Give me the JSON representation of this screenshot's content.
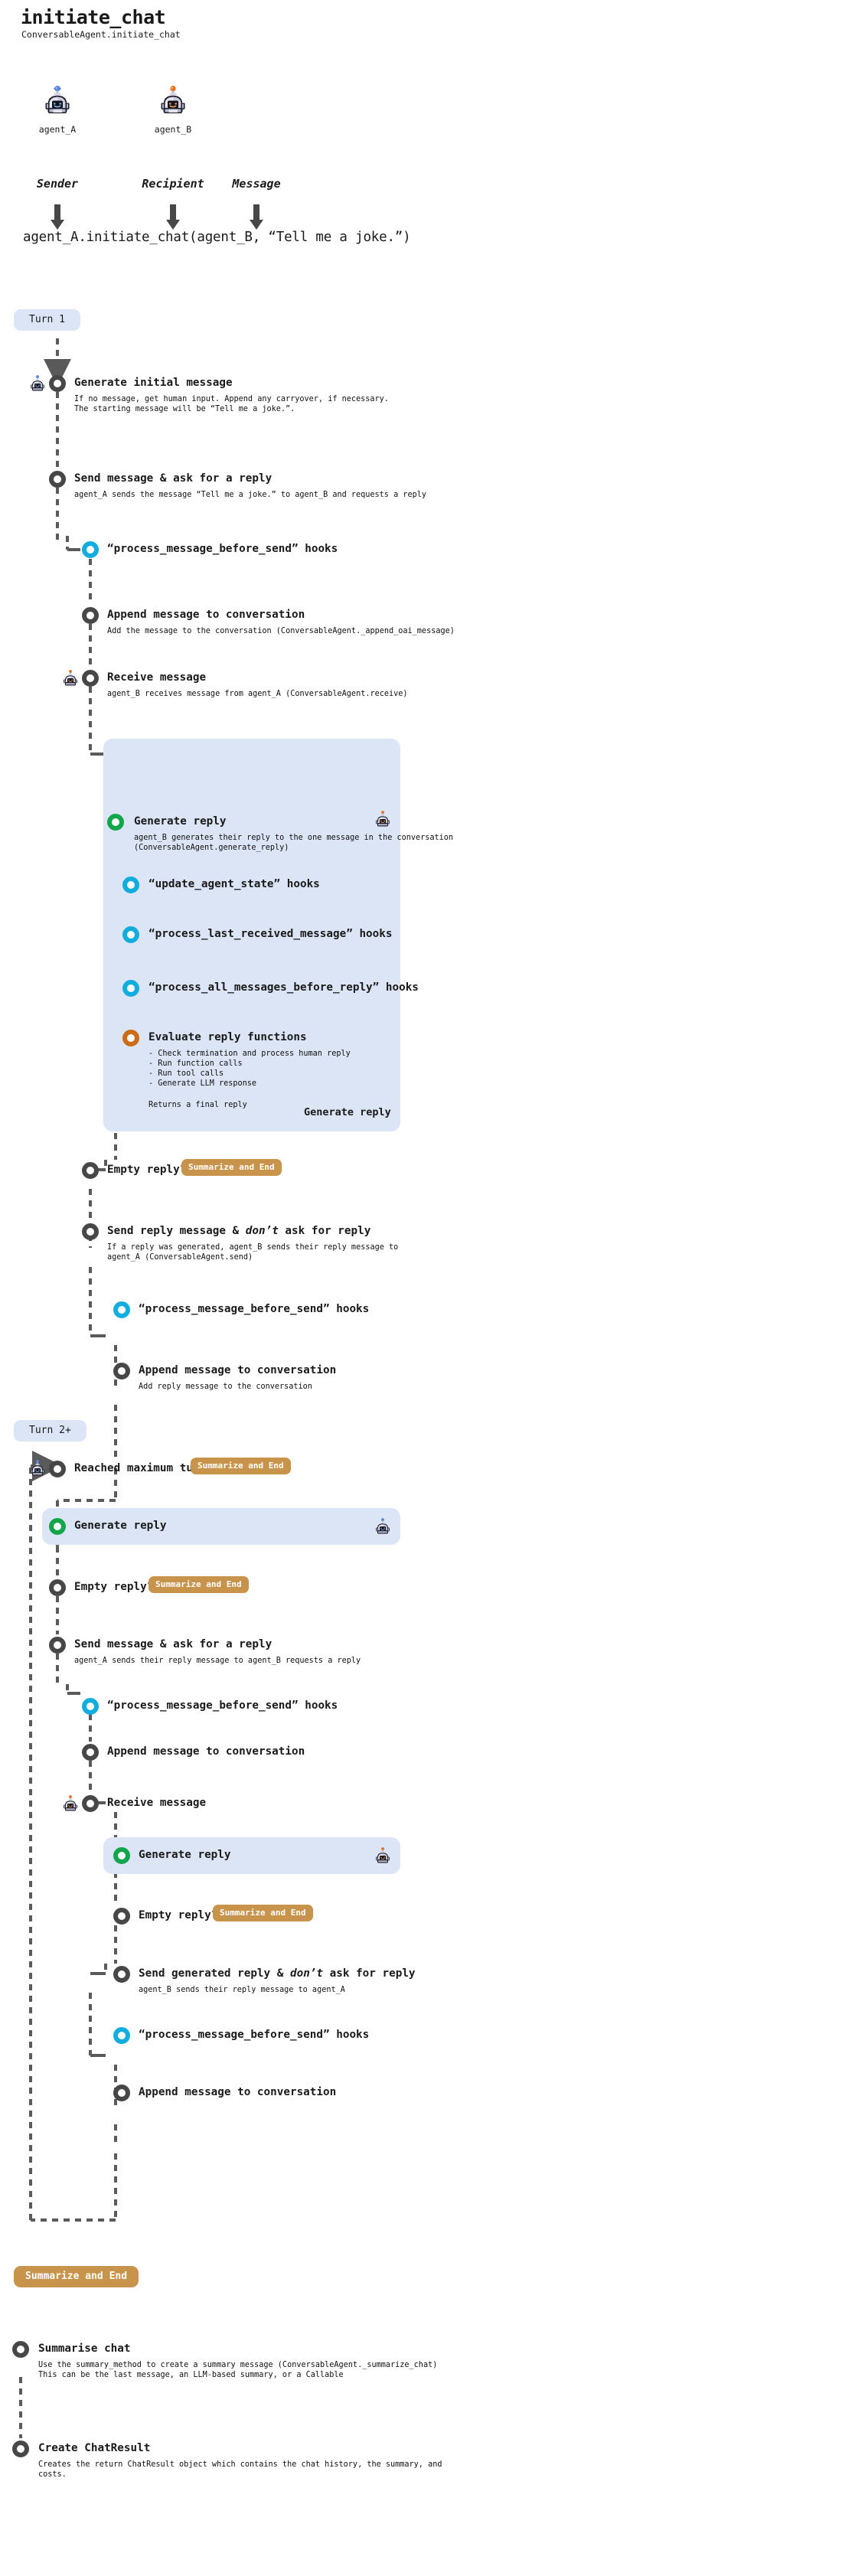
{
  "header": {
    "title": "initiate_chat",
    "subtitle": "ConversableAgent.initiate_chat",
    "agent_a_name": "agent_A",
    "agent_b_name": "agent_B",
    "role_sender": "Sender",
    "role_recipient": "Recipient",
    "role_message": "Message",
    "call_line": "agent_A.initiate_chat(agent_B, “Tell me a joke.”)"
  },
  "colors": {
    "node_dark": "#474747",
    "node_green": "#11a64a",
    "node_cyan": "#12addf",
    "node_orange": "#cc6b16",
    "highlight_bg": "#dbe5f5",
    "badge_bg": "#c8944c",
    "turn_badge_bg": "#dbe5f5",
    "line": "#5a5a5a"
  },
  "turn1": {
    "badge": "Turn 1",
    "steps": [
      {
        "id": "generate-initial-message",
        "label": "Generate initial message",
        "desc": "If no message, get human input. Append any carryover, if necessary.\nThe starting message will be “Tell me a joke.”.",
        "node": "dark",
        "agent_icon": "agent_A"
      },
      {
        "id": "send-message-ask-reply",
        "label": "Send message & ask for a reply",
        "desc": "agent_A sends the message “Tell me a joke.” to agent_B and requests a reply",
        "node": "dark"
      },
      {
        "id": "process-message-before-send-hook-1",
        "label": "“process_message_before_send” hooks",
        "desc": "",
        "node": "cyan"
      },
      {
        "id": "append-message-to-conversation-1",
        "label": "Append message to conversation",
        "desc": "Add the message to the conversation (ConversableAgent._append_oai_message)",
        "node": "dark"
      },
      {
        "id": "receive-message-1",
        "label": "Receive message",
        "desc": "agent_B receives message from agent_A (ConversableAgent.receive)",
        "node": "dark",
        "agent_icon": "agent_B"
      }
    ],
    "generate_reply_block": {
      "label": "Generate reply",
      "desc": "agent_B generates their reply to the one message in the conversation\n(ConversableAgent.generate_reply)",
      "footer_label": "Generate reply",
      "agent_icon": "agent_B",
      "inner": [
        {
          "id": "update-agent-state-hooks",
          "label": "“update_agent_state” hooks",
          "node": "cyan"
        },
        {
          "id": "process-last-received-message-hooks",
          "label": "“process_last_received_message” hooks",
          "node": "cyan"
        },
        {
          "id": "process-all-messages-before-reply-hooks",
          "label": "“process_all_messages_before_reply” hooks",
          "node": "cyan"
        },
        {
          "id": "evaluate-reply-functions",
          "label": "Evaluate reply functions",
          "node": "orange",
          "bullets": [
            "- Check termination and process human reply",
            "- Run function calls",
            "- Run tool calls",
            "- Generate LLM response"
          ],
          "returns": "Returns a final reply"
        }
      ]
    },
    "post_steps": [
      {
        "id": "empty-reply-1",
        "label": "Empty reply?",
        "badge": "Summarize and End",
        "node": "dark"
      },
      {
        "id": "send-reply-dont-ask",
        "label_parts": [
          "Send reply message & ",
          "don’t",
          " ask for reply"
        ],
        "desc": "If a reply was generated, agent_B sends their reply message to\nagent_A (ConversableAgent.send)",
        "node": "dark"
      },
      {
        "id": "process-message-before-send-hook-2",
        "label": "“process_message_before_send” hooks",
        "node": "cyan"
      },
      {
        "id": "append-message-to-conversation-2",
        "label": "Append message to conversation",
        "desc": "Add reply message to the conversation",
        "node": "dark"
      }
    ]
  },
  "turn2": {
    "badge": "Turn 2+",
    "steps": [
      {
        "id": "reached-maximum-turns",
        "label": "Reached maximum turns?",
        "badge": "Summarize and End",
        "node": "dark",
        "agent_icon": "agent_A"
      },
      {
        "id": "generate-reply-a",
        "label": "Generate reply",
        "node": "green",
        "highlight": true,
        "agent_icon": "agent_A"
      },
      {
        "id": "empty-reply-2",
        "label": "Empty reply?",
        "badge": "Summarize and End",
        "node": "dark"
      },
      {
        "id": "send-message-ask-reply-2",
        "label": "Send message & ask for a reply",
        "desc": "agent_A sends their reply message to agent_B requests a reply",
        "node": "dark"
      },
      {
        "id": "process-message-before-send-hook-3",
        "label": "“process_message_before_send” hooks",
        "node": "cyan"
      },
      {
        "id": "append-message-to-conversation-3",
        "label": "Append message to conversation",
        "node": "dark"
      },
      {
        "id": "receive-message-2",
        "label": "Receive message",
        "node": "dark",
        "agent_icon": "agent_B"
      },
      {
        "id": "generate-reply-b",
        "label": "Generate reply",
        "node": "green",
        "highlight": true,
        "agent_icon": "agent_B"
      },
      {
        "id": "empty-reply-3",
        "label": "Empty reply?",
        "badge": "Summarize and End",
        "node": "dark"
      },
      {
        "id": "send-generated-reply-dont-ask",
        "label_parts": [
          "Send generated reply & ",
          "don’t",
          " ask for reply"
        ],
        "desc": "agent_B sends their reply message to agent_A",
        "node": "dark"
      },
      {
        "id": "process-message-before-send-hook-4",
        "label": "“process_message_before_send” hooks",
        "node": "cyan"
      },
      {
        "id": "append-message-to-conversation-4",
        "label": "Append message to conversation",
        "node": "dark"
      }
    ]
  },
  "summarize": {
    "badge": "Summarize and End",
    "steps": [
      {
        "id": "summarise-chat",
        "label": "Summarise chat",
        "desc": "Use the summary_method to create a summary message (ConversableAgent._summarize_chat)\nThis can be the last message, an LLM-based summary, or a Callable",
        "node": "dark"
      },
      {
        "id": "create-chatresult",
        "label": "Create ChatResult",
        "desc": "Creates the return ChatResult object which contains the chat history, the summary, and\ncosts.",
        "node": "dark"
      }
    ]
  }
}
